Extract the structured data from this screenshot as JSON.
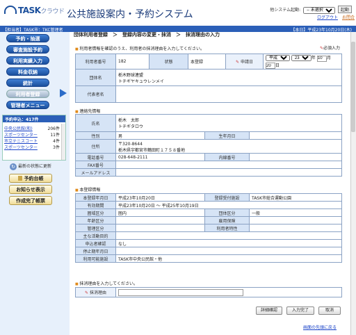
{
  "header": {
    "logo_text": "TASK",
    "logo_kana": "クラウド",
    "system_title": "公共施設案内・予約システム",
    "sys_start_label": "他システム起動:",
    "sys_select_value": "-- 未選択 --",
    "start_button": "起動",
    "logout_link": "ログアウト",
    "other_link": "お問合"
  },
  "userbar": {
    "left": "【担当者】TASK市：TKC管理者",
    "right": "【本日】平成23年10月20日(木)"
  },
  "sidebar": {
    "nav": [
      "予約・抽選",
      "審査施設予約",
      "利用実績入力",
      "料金収納",
      "統計",
      "利用者登録",
      "管理者メニュー"
    ],
    "active_index": 5,
    "reservation_header": "予約申込：417件",
    "reservations": [
      {
        "name": "中央公民館(和)",
        "count": "206件"
      },
      {
        "name": "スポーツセンター",
        "count": "11件"
      },
      {
        "name": "市立テニスコート",
        "count": "4件"
      },
      {
        "name": "スポーツセンター",
        "count": "3件"
      }
    ],
    "refresh_label": "最新の状態に更新",
    "buttons": [
      "予約台帳",
      "お知らせ表示",
      "作成完了帳票"
    ]
  },
  "breadcrumb": "団体利用者登録　＞　登録内容の変更・抹消　＞　抹消理由の入力",
  "notice": "利用者情報を確認のうえ、利用者の抹消理由を入力してください。",
  "required_mark": "必須入力",
  "basic": {
    "user_no_label": "利用者番号",
    "user_no": "182",
    "status_label": "状態",
    "status": "本登録",
    "apply_date_label": "申請日",
    "era": "平成",
    "year": "23",
    "year_unit": "年",
    "month": "10",
    "month_unit": "月",
    "day": "20",
    "day_unit": "日",
    "group_name_label": "団体名",
    "group_name": "栃木野球連盟",
    "group_kana": "トチギヤキュウレンメイ",
    "rep_label": "代表者名",
    "rep_value": ""
  },
  "contact": {
    "title": "連絡先情報",
    "name_label": "氏名",
    "name": "栃木　太郎",
    "name_kana": "トチギタロウ",
    "sex_label": "性別",
    "sex": "男",
    "birth_label": "生年月日",
    "birth": "",
    "addr_label": "住所",
    "zip": "〒320-8644",
    "addr": "栃木県宇都宮市鶴田町１７５８番地",
    "tel_label": "電話番号",
    "tel": "028-648-2111",
    "ext_label": "内線番号",
    "ext": "",
    "fax_label": "FAX番号",
    "fax": "",
    "mail_label": "メールアドレス",
    "mail": ""
  },
  "registration": {
    "title": "本登録情報",
    "reg_date_label": "本登録年月日",
    "reg_date": "平成23年10月20日",
    "reg_facility_label": "登録受付施設",
    "reg_facility": "TASK市総合運動公園",
    "valid_label": "有効期間",
    "valid": "平成23年10月20日 ～ 平成25年10月19日",
    "area_label": "圏域区分",
    "area": "圏内",
    "group_kind_label": "団体区分",
    "group_kind": "一般",
    "age_label": "年齢区分",
    "age": "",
    "employ_label": "雇用保険",
    "employ": "",
    "manage_label": "管理区分",
    "manage": "",
    "feature_label": "利用者特性",
    "feature": "",
    "purpose_label": "主な活動目的",
    "purpose": "",
    "confirm_label": "申込者確認",
    "confirm": "なし",
    "stop_label": "停止期年月日",
    "stop": "",
    "avail_label": "利用可能施設",
    "avail": "TASK市中央公民館・他"
  },
  "reason": {
    "prompt": "抹消理由を入力してください。",
    "label": "抹消理由",
    "value": ""
  },
  "actions": {
    "detail": "詳細確認",
    "complete": "入力完了",
    "cancel": "取消",
    "back_top": "画面の先頭に戻る"
  }
}
